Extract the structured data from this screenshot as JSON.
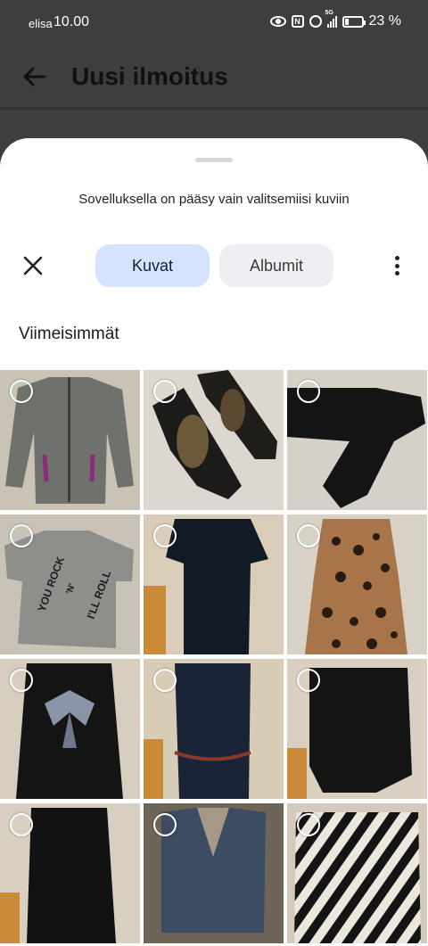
{
  "status_bar": {
    "carrier": "elisa",
    "time": "10.00",
    "network": "5G",
    "battery": "23 %",
    "battery_level": 0.23,
    "icons": [
      "eye-icon",
      "nfc-icon",
      "alarm-icon",
      "signal-icon",
      "battery-icon"
    ]
  },
  "app_bar": {
    "title": "Uusi ilmoitus",
    "back_icon": "arrow-left-icon"
  },
  "sheet": {
    "permission_text": "Sovelluksella on pääsy vain valitsemiisi kuviin",
    "tabs": [
      {
        "label": "Kuvat",
        "selected": true
      },
      {
        "label": "Albumit",
        "selected": false
      }
    ],
    "section_title": "Viimeisimmät",
    "photos": [
      {
        "subject": "grey zip jacket with purple trim"
      },
      {
        "subject": "black high heel shoes"
      },
      {
        "subject": "black trousers"
      },
      {
        "subject": "grey t-shirt with print",
        "print_text": [
          "YOU ROCK",
          "'N'",
          "I'LL ROLL"
        ]
      },
      {
        "subject": "black short-sleeve dress"
      },
      {
        "subject": "leopard print dress"
      },
      {
        "subject": "black top with butterfly design"
      },
      {
        "subject": "denim dress with belt"
      },
      {
        "subject": "black loose top"
      },
      {
        "subject": "black long-sleeve dress"
      },
      {
        "subject": "denim vest"
      },
      {
        "subject": "black and white striped sweater"
      }
    ]
  },
  "colors": {
    "scrim": "#3e3e3e",
    "sheet_background": "#ffffff",
    "selected_tab": "#d6e3ff",
    "unselected_tab": "#efeff3"
  }
}
